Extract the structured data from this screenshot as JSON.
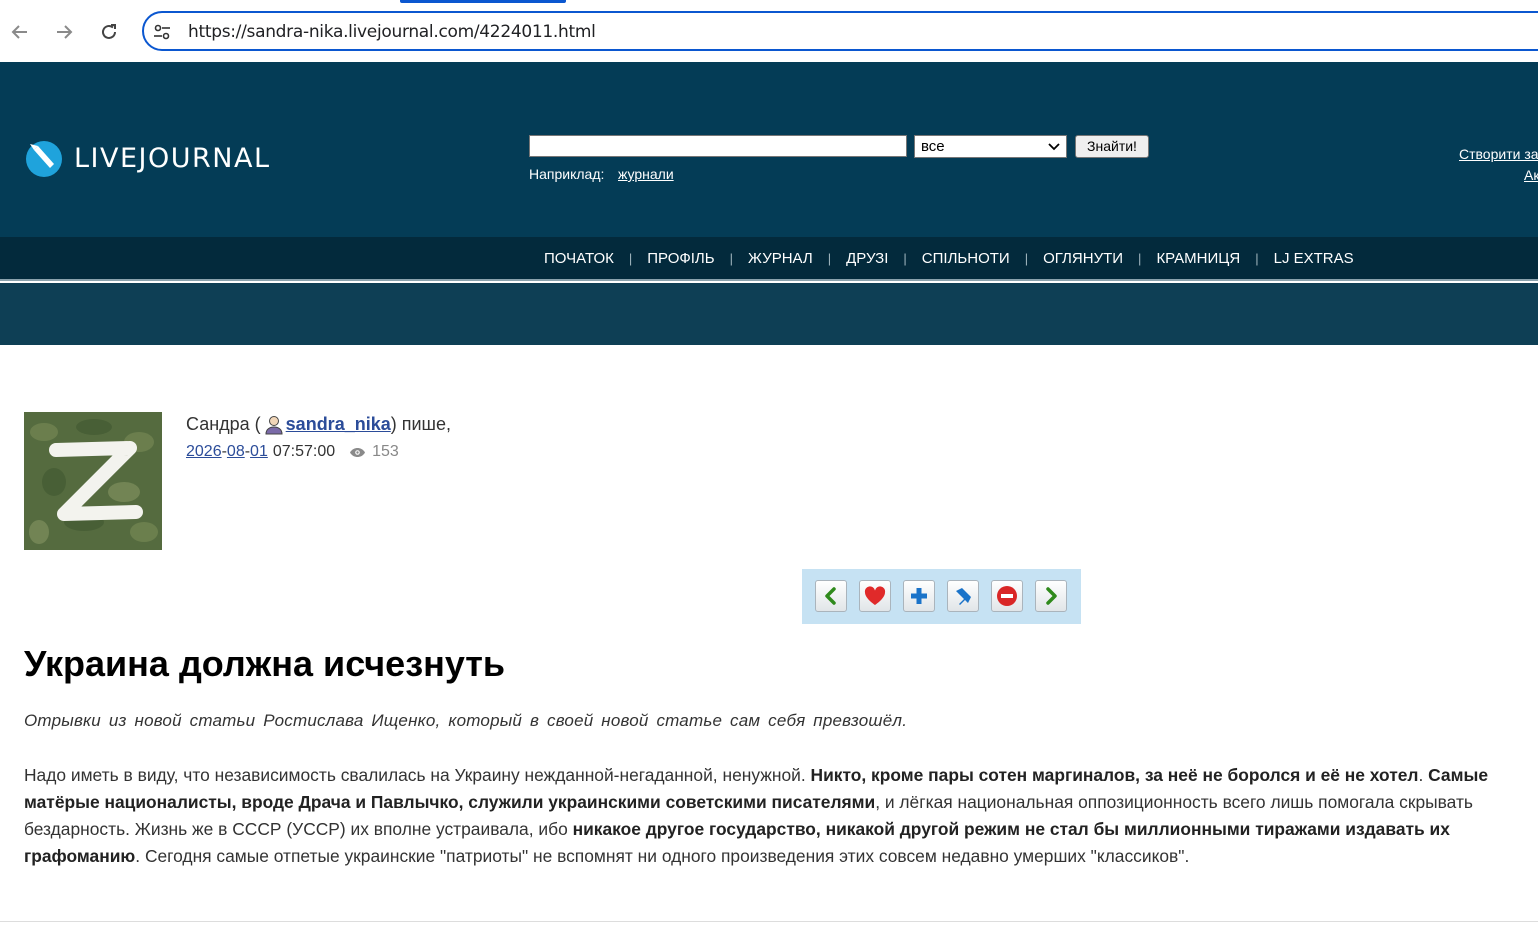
{
  "browser": {
    "url": "https://sandra-nika.livejournal.com/4224011.html"
  },
  "header": {
    "logo_text": "LIVEJOURNAL",
    "search_select_value": "все",
    "search_button": "Знайти!",
    "example_label": "Наприклад:",
    "example_link": "журнали",
    "create_link": "Створити за",
    "login_link": "Ак"
  },
  "nav": {
    "items": [
      "ПОЧАТОК",
      "ПРОФІЛЬ",
      "ЖУРНАЛ",
      "ДРУЗІ",
      "СПІЛЬНОТИ",
      "ОГЛЯНУТИ",
      "КРАМНИЦЯ",
      "LJ EXTRAS"
    ]
  },
  "post": {
    "author_name": "Сандра (",
    "username": "sandra_nika",
    "writes": ") пише,",
    "date_year": "2026",
    "date_month": "08",
    "date_day": "01",
    "time": "07:57:00",
    "views": "153",
    "title": "Украина должна исчезнуть",
    "lead": "Отрывки  из  новой статьи Ростислава  Ищенко, который в  своей новой статье  сам  себя  превзошёл.",
    "body_parts": [
      {
        "text": "Надо иметь в виду, что независимость свалилась на Украину нежданной-негаданной, ненужной. ",
        "bold": false
      },
      {
        "text": "Никто, кроме пары сотен маргиналов, за неё не боролся и её не хотел",
        "bold": true
      },
      {
        "text": ". ",
        "bold": false
      },
      {
        "text": "Самые матёрые националисты, вроде Драча и Павлычко, служили украинскими советскими писателями",
        "bold": true
      },
      {
        "text": ", и лёгкая национальная оппозиционность всего лишь помогала скрывать бездарность. Жизнь же в СССР (УССР) их вполне устраивала, ибо ",
        "bold": false
      },
      {
        "text": "никакое другое государство, никакой другой режим не стал бы миллионными тиражами издавать их графоманию",
        "bold": true
      },
      {
        "text": ". Сегодня самые отпетые украинские \"патриоты\" не вспомнят ни одного произведения этих совсем недавно умерших \"классиков\".",
        "bold": false
      }
    ]
  },
  "colors": {
    "header_bg": "#043c56",
    "nav_bg": "#032a3c",
    "link": "#2b4c99",
    "action_bar_bg": "#c6e2f3"
  }
}
